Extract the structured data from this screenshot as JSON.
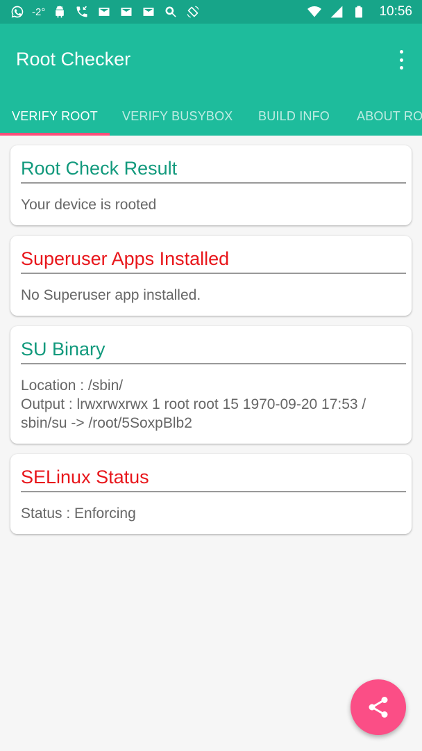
{
  "statusbar": {
    "temperature": "-2°",
    "time": "10:56"
  },
  "app": {
    "title": "Root Checker"
  },
  "tabs": [
    {
      "label": "VERIFY ROOT"
    },
    {
      "label": "VERIFY BUSYBOX"
    },
    {
      "label": "BUILD INFO"
    },
    {
      "label": "ABOUT ROOT"
    }
  ],
  "cards": [
    {
      "title": "Root Check Result",
      "lines": [
        "Your device is rooted"
      ]
    },
    {
      "title": "Superuser Apps Installed",
      "lines": [
        "No Superuser app installed."
      ]
    },
    {
      "title": "SU Binary",
      "lines": [
        "Location : /sbin/",
        "Output : lrwxrwxrwx 1 root root 15 1970-09-20 17:53 /",
        "sbin/su -> /root/5SoxpBlb2"
      ]
    },
    {
      "title": "SELinux Status",
      "lines": [
        "Status : Enforcing"
      ]
    }
  ],
  "colors": {
    "primary": "#1ebc9c",
    "status_bar": "#17a589",
    "accent": "#fb4e86",
    "title_green": "#11997c",
    "title_red": "#e8161b"
  },
  "icons": {
    "fab": "share-icon",
    "menu": "more-vertical-icon"
  }
}
